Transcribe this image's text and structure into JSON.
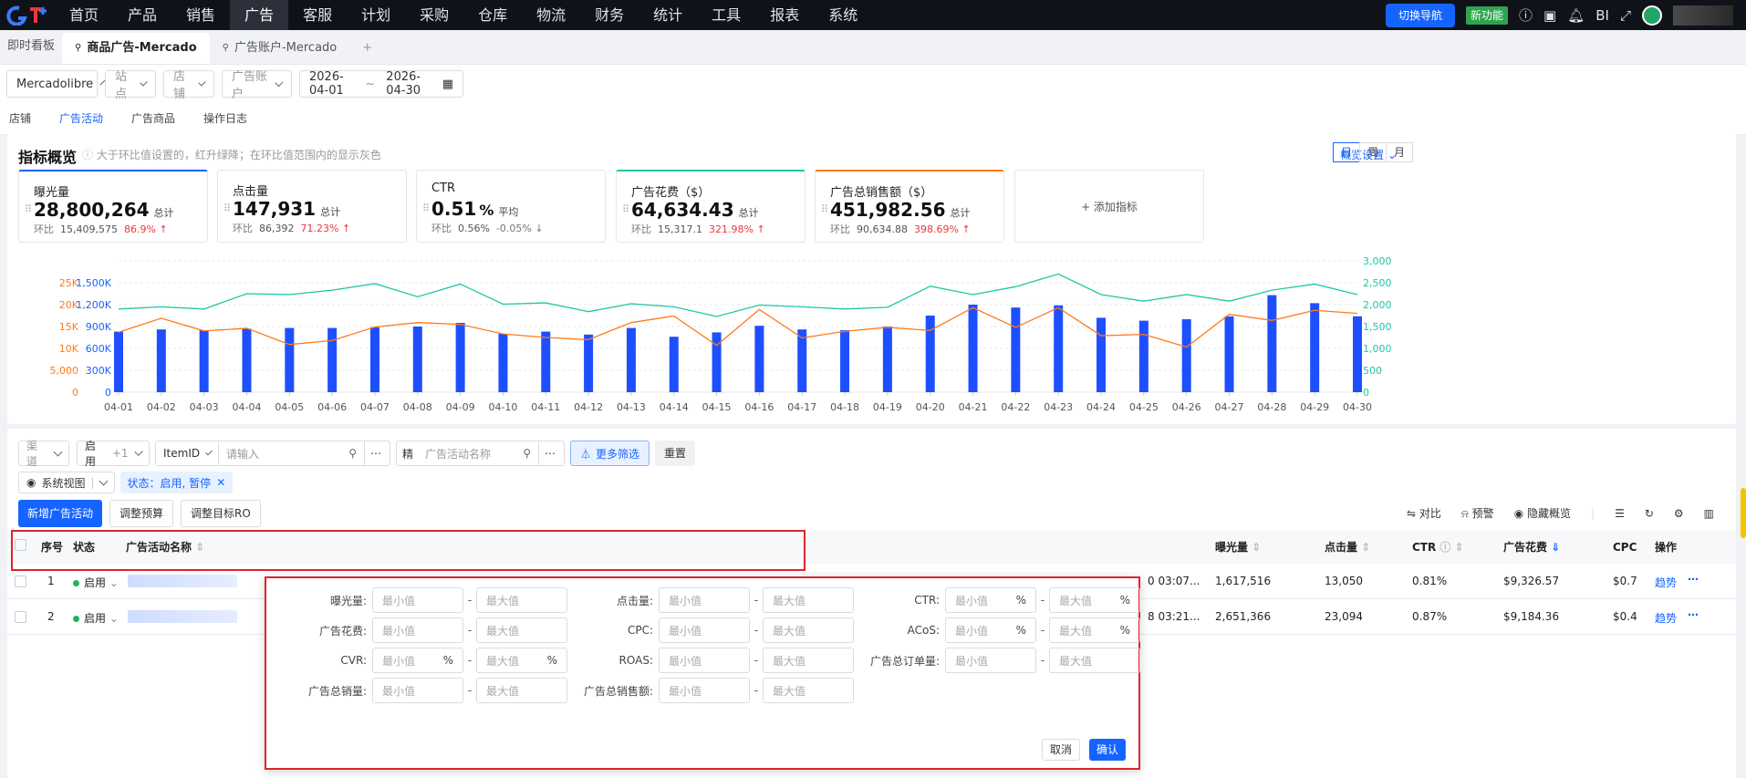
{
  "nav": {
    "items": [
      "首页",
      "产品",
      "销售",
      "广告",
      "客服",
      "计划",
      "采购",
      "仓库",
      "物流",
      "财务",
      "统计",
      "工具",
      "报表",
      "系统"
    ],
    "active_index": 3,
    "switch_label": "切换导航",
    "new_label": "新功能",
    "bi_label": "BI"
  },
  "tabs": {
    "dashboard": "即时看板",
    "items": [
      "商品广告-Mercado",
      "广告账户-Mercado"
    ],
    "active_index": 0,
    "add": "+"
  },
  "filters": {
    "platform": "Mercadolibre",
    "site": "站点",
    "shop": "店铺",
    "account": "广告账户",
    "date_start": "2026-04-01",
    "date_sep": "~",
    "date_end": "2026-04-30"
  },
  "subtabs": {
    "items": [
      "店铺",
      "广告活动",
      "广告商品",
      "操作日志"
    ],
    "active_index": 1
  },
  "overview": {
    "title": "指标概览",
    "hint": "大于环比值设置的，红升绿降；在环比值范围内的显示灰色",
    "settings": "概览设置",
    "periods": [
      "日",
      "周",
      "月"
    ],
    "active_period": 0,
    "add_metric": "+ 添加指标",
    "kpis": [
      {
        "name": "曝光量",
        "value": "28,800,264",
        "agg": "总计",
        "cmp_label": "环比",
        "cmp_value": "15,409,575",
        "change": "86.9%",
        "dir": "up",
        "accent": "#1664ff"
      },
      {
        "name": "点击量",
        "value": "147,931",
        "agg": "总计",
        "cmp_label": "环比",
        "cmp_value": "86,392",
        "change": "71.23%",
        "dir": "up",
        "accent": ""
      },
      {
        "name": "CTR",
        "value": "0.51",
        "unit": "%",
        "agg": "平均",
        "cmp_label": "环比",
        "cmp_value": "0.56%",
        "change": "-0.05%",
        "dir": "down",
        "accent": ""
      },
      {
        "name": "广告花费（$）",
        "value": "64,634.43",
        "agg": "总计",
        "cmp_label": "环比",
        "cmp_value": "15,317.1",
        "change": "321.98%",
        "dir": "up",
        "accent": "#1fc7a6"
      },
      {
        "name": "广告总销售额（$）",
        "value": "451,982.56",
        "agg": "总计",
        "cmp_label": "环比",
        "cmp_value": "90,634.88",
        "change": "398.69%",
        "dir": "up",
        "accent": "#ff7a1a"
      }
    ]
  },
  "chart_data": {
    "type": "bar",
    "categories": [
      "04-01",
      "04-02",
      "04-03",
      "04-04",
      "04-05",
      "04-06",
      "04-07",
      "04-08",
      "04-09",
      "04-10",
      "04-11",
      "04-12",
      "04-13",
      "04-14",
      "04-15",
      "04-16",
      "04-17",
      "04-18",
      "04-19",
      "04-20",
      "04-21",
      "04-22",
      "04-23",
      "04-24",
      "04-25",
      "04-26",
      "04-27",
      "04-28",
      "04-29",
      "04-30"
    ],
    "axes": {
      "left_outer": {
        "ticks": [
          "0",
          "5,000",
          "10K",
          "15K",
          "20K",
          "25K"
        ],
        "max": 25000,
        "color": "#ff7a1a"
      },
      "left_inner": {
        "ticks": [
          "0",
          "300K",
          "600K",
          "900K",
          "1,200K",
          "1,500K"
        ],
        "max": 1500000,
        "color": "#1664ff"
      },
      "right": {
        "ticks": [
          "0",
          "500",
          "1,000",
          "1,500",
          "2,000",
          "2,500",
          "3,000"
        ],
        "max": 3000,
        "color": "#1fc7a6"
      }
    },
    "series": [
      {
        "type": "bar",
        "axis": "left_inner",
        "color": "#1e4fff",
        "values": [
          830000,
          860000,
          850000,
          870000,
          880000,
          880000,
          890000,
          900000,
          950000,
          800000,
          830000,
          790000,
          880000,
          760000,
          820000,
          910000,
          860000,
          850000,
          900000,
          1050000,
          1200000,
          1160000,
          1190000,
          1020000,
          980000,
          1000000,
          1040000,
          1330000,
          1220000,
          1040000
        ]
      },
      {
        "type": "line",
        "axis": "right",
        "color": "#1fc7a6",
        "values": [
          1900,
          1950,
          1900,
          2250,
          2230,
          2330,
          2480,
          2180,
          2470,
          2010,
          2040,
          1840,
          2020,
          1950,
          1730,
          1990,
          1950,
          1900,
          1940,
          2420,
          2230,
          2410,
          2700,
          2230,
          2080,
          2230,
          2080,
          2330,
          2470,
          2230
        ]
      },
      {
        "type": "line",
        "axis": "left_outer",
        "color": "#ff7a1a",
        "values": [
          13700,
          16900,
          14000,
          14600,
          10900,
          11800,
          14900,
          15900,
          15500,
          13300,
          12500,
          12000,
          15900,
          17400,
          10700,
          18900,
          12400,
          13900,
          14800,
          14100,
          19300,
          14800,
          19300,
          12900,
          13200,
          10300,
          17800,
          16400,
          18700,
          18000
        ]
      }
    ]
  },
  "table_filters": {
    "channel": "渠道",
    "status": "启用",
    "status_extra": "+1",
    "item_type": "ItemID",
    "item_placeholder": "请输入",
    "exact": "精",
    "name_placeholder": "广告活动名称",
    "more": "更多筛选",
    "reset": "重置"
  },
  "toolbar": {
    "view": "系统视图",
    "status_chip": "状态：启用, 暂停",
    "new_campaign": "新增广告活动",
    "adjust_budget": "调整预算",
    "adjust_target": "调整目标RO",
    "compare": "对比",
    "alert": "预警",
    "hide_overview": "隐藏概览"
  },
  "table": {
    "columns": [
      "序号",
      "状态",
      "广告活动名称",
      "曝光量",
      "点击量",
      "CTR",
      "广告花费",
      "CPC",
      "操作"
    ],
    "rows": [
      {
        "index": "1",
        "status": "启用",
        "time": "0 03:07...",
        "impressions": "1,617,516",
        "clicks": "13,050",
        "ctr": "0.81%",
        "spend": "$9,326.57",
        "cpc": "$0.7",
        "trend": "趋势"
      },
      {
        "index": "2",
        "status": "启用",
        "time": "8 03:21...",
        "impressions": "2,651,366",
        "clicks": "23,094",
        "ctr": "0.87%",
        "spend": "$9,184.36",
        "cpc": "$0.4",
        "trend": "趋势"
      }
    ]
  },
  "popup": {
    "min": "最小值",
    "max": "最大值",
    "rows": [
      [
        {
          "label": "曝光量:",
          "unit": ""
        },
        {
          "label": "点击量:",
          "unit": ""
        },
        {
          "label": "CTR:",
          "unit": "%"
        }
      ],
      [
        {
          "label": "广告花费:",
          "unit": ""
        },
        {
          "label": "CPC:",
          "unit": ""
        },
        {
          "label": "ACoS:",
          "unit": "%"
        }
      ],
      [
        {
          "label": "CVR:",
          "unit": "%"
        },
        {
          "label": "ROAS:",
          "unit": ""
        },
        {
          "label": "广告总订单量:",
          "unit": ""
        }
      ],
      [
        {
          "label": "广告总销量:",
          "unit": ""
        },
        {
          "label": "广告总销售额:",
          "unit": ""
        }
      ]
    ],
    "cancel": "取消",
    "confirm": "确认"
  }
}
